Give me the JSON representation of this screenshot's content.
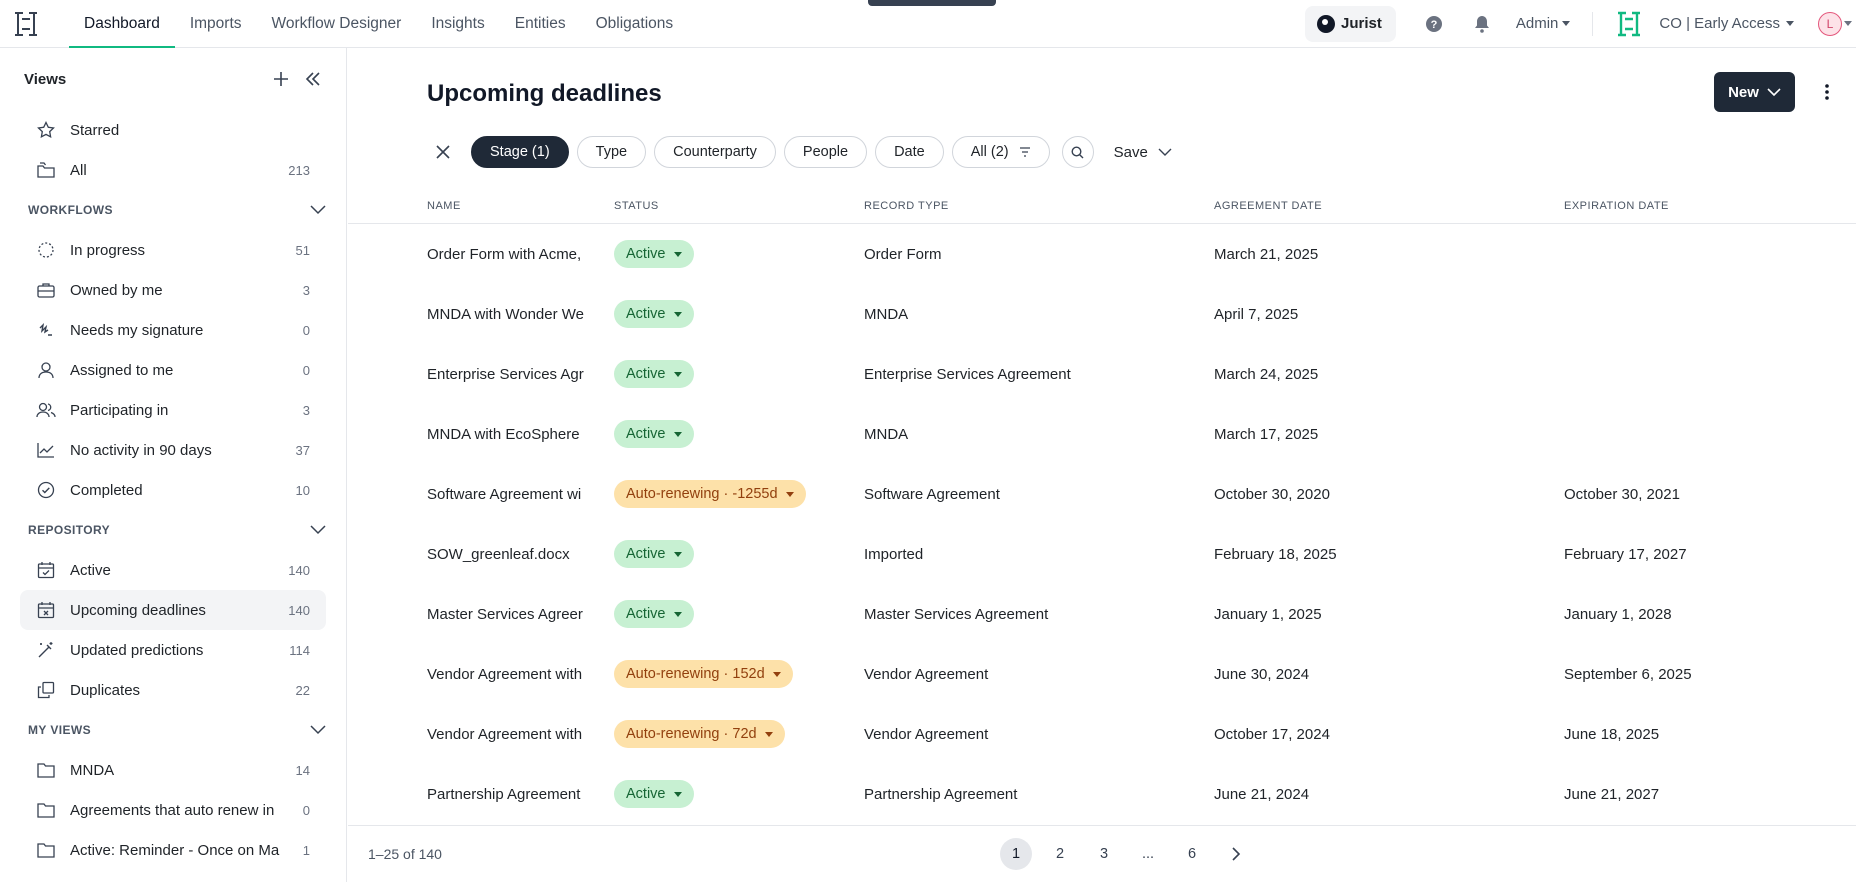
{
  "topnav": {
    "tabs": [
      {
        "label": "Dashboard"
      },
      {
        "label": "Imports"
      },
      {
        "label": "Workflow Designer"
      },
      {
        "label": "Insights"
      },
      {
        "label": "Entities"
      },
      {
        "label": "Obligations"
      }
    ],
    "jurist_label": "Jurist",
    "admin_label": "Admin",
    "org_label": "CO | Early Access",
    "avatar_initial": "L"
  },
  "sidebar": {
    "title": "Views",
    "top_items": [
      {
        "label": "Starred",
        "count": ""
      },
      {
        "label": "All",
        "count": "213"
      }
    ],
    "workflows_title": "WORKFLOWS",
    "workflows": [
      {
        "label": "In progress",
        "count": "51"
      },
      {
        "label": "Owned by me",
        "count": "3"
      },
      {
        "label": "Needs my signature",
        "count": "0"
      },
      {
        "label": "Assigned to me",
        "count": "0"
      },
      {
        "label": "Participating in",
        "count": "3"
      },
      {
        "label": "No activity in 90 days",
        "count": "37"
      },
      {
        "label": "Completed",
        "count": "10"
      }
    ],
    "repository_title": "REPOSITORY",
    "repository": [
      {
        "label": "Active",
        "count": "140"
      },
      {
        "label": "Upcoming deadlines",
        "count": "140"
      },
      {
        "label": "Updated predictions",
        "count": "114"
      },
      {
        "label": "Duplicates",
        "count": "22"
      }
    ],
    "myviews_title": "MY VIEWS",
    "myviews": [
      {
        "label": "MNDA",
        "count": "14"
      },
      {
        "label": "Agreements that auto renew in",
        "count": "0"
      },
      {
        "label": "Active: Reminder - Once on Ma",
        "count": "1"
      }
    ]
  },
  "main": {
    "title": "Upcoming deadlines",
    "new_label": "New",
    "filters": {
      "stage": "Stage (1)",
      "type": "Type",
      "counterparty": "Counterparty",
      "people": "People",
      "date": "Date",
      "all": "All (2)",
      "save": "Save"
    },
    "columns": {
      "name": "NAME",
      "status": "STATUS",
      "record_type": "RECORD TYPE",
      "agreement_date": "AGREEMENT DATE",
      "expiration_date": "EXPIRATION DATE"
    },
    "rows": [
      {
        "name": "Order Form with Acme,",
        "status": "Active",
        "status_kind": "active",
        "record_type": "Order Form",
        "agreement_date": "March 21, 2025",
        "expiration_date": ""
      },
      {
        "name": "MNDA with Wonder We",
        "status": "Active",
        "status_kind": "active",
        "record_type": "MNDA",
        "agreement_date": "April 7, 2025",
        "expiration_date": ""
      },
      {
        "name": "Enterprise Services Agr",
        "status": "Active",
        "status_kind": "active",
        "record_type": "Enterprise Services Agreement",
        "agreement_date": "March 24, 2025",
        "expiration_date": ""
      },
      {
        "name": "MNDA with EcoSphere",
        "status": "Active",
        "status_kind": "active",
        "record_type": "MNDA",
        "agreement_date": "March 17, 2025",
        "expiration_date": ""
      },
      {
        "name": "Software Agreement wi",
        "status": "Auto-renewing · -1255d",
        "status_kind": "auto",
        "record_type": "Software Agreement",
        "agreement_date": "October 30, 2020",
        "expiration_date": "October 30, 2021"
      },
      {
        "name": "SOW_greenleaf.docx",
        "status": "Active",
        "status_kind": "active",
        "record_type": "Imported",
        "agreement_date": "February 18, 2025",
        "expiration_date": "February 17, 2027"
      },
      {
        "name": "Master Services Agreer",
        "status": "Active",
        "status_kind": "active",
        "record_type": "Master Services Agreement",
        "agreement_date": "January 1, 2025",
        "expiration_date": "January 1, 2028"
      },
      {
        "name": "Vendor Agreement with",
        "status": "Auto-renewing · 152d",
        "status_kind": "auto",
        "record_type": "Vendor Agreement",
        "agreement_date": "June 30, 2024",
        "expiration_date": "September 6, 2025"
      },
      {
        "name": "Vendor Agreement with",
        "status": "Auto-renewing · 72d",
        "status_kind": "auto",
        "record_type": "Vendor Agreement",
        "agreement_date": "October 17, 2024",
        "expiration_date": "June 18, 2025"
      },
      {
        "name": "Partnership Agreement",
        "status": "Active",
        "status_kind": "active",
        "record_type": "Partnership Agreement",
        "agreement_date": "June 21, 2024",
        "expiration_date": "June 21, 2027"
      }
    ],
    "pagination": {
      "range_text": "1–25 of 140",
      "pages": [
        "1",
        "2",
        "3",
        "...",
        "6"
      ],
      "current": "1"
    }
  },
  "colors": {
    "accent": "#10b981",
    "active_bg": "#c7f0d2",
    "active_fg": "#166534",
    "auto_bg": "#fde1a9",
    "auto_fg": "#92400e",
    "primary_button": "#1f2937"
  }
}
